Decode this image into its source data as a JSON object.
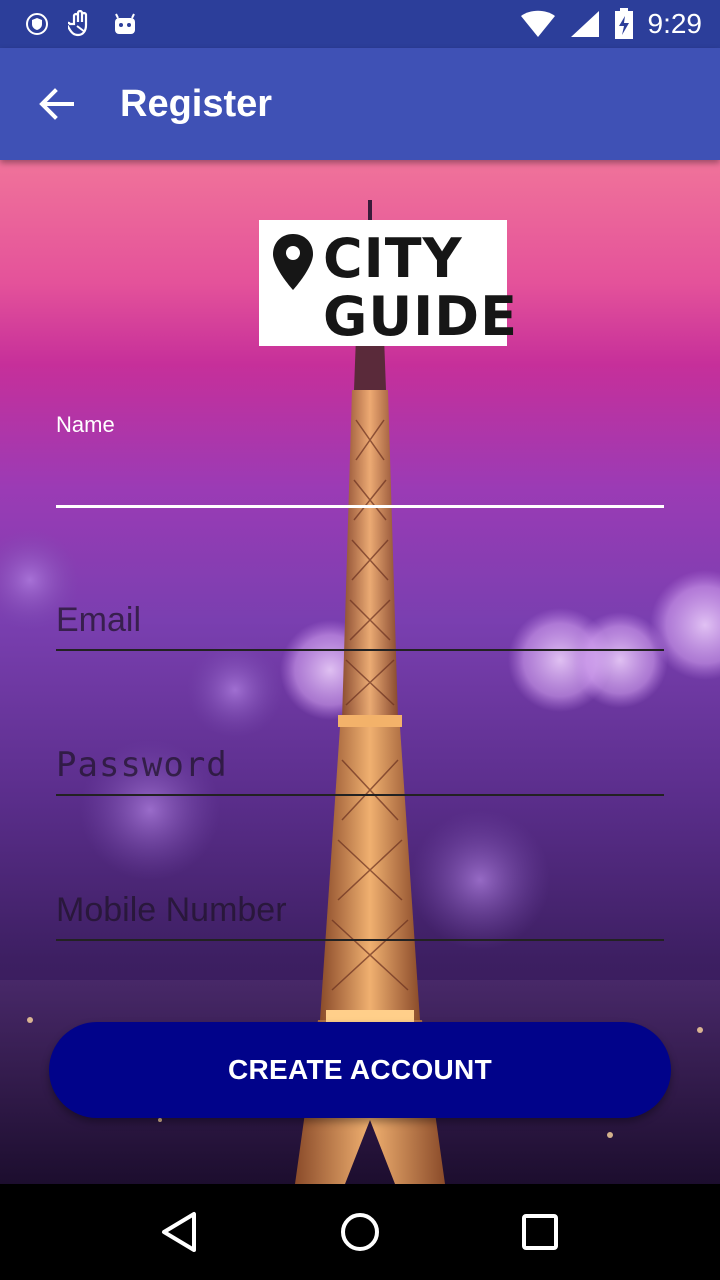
{
  "status_bar": {
    "time": "9:29",
    "left_icons": [
      "shield-icon",
      "hand-icon",
      "android-icon"
    ],
    "right_icons": [
      "wifi-icon",
      "signal-icon",
      "battery-charging-icon"
    ]
  },
  "app_bar": {
    "title": "Register",
    "back_icon": "arrow-back-icon",
    "color": "#3f51b5"
  },
  "logo": {
    "line1": "CITY",
    "line2": "GUIDE",
    "icon": "location-pin-icon"
  },
  "form": {
    "name": {
      "label": "Name",
      "value": ""
    },
    "email": {
      "placeholder": "Email"
    },
    "password": {
      "placeholder": "Password"
    },
    "mobile": {
      "placeholder": "Mobile Number"
    }
  },
  "button": {
    "label": "CREATE ACCOUNT",
    "color": "#01038a"
  },
  "nav_bar": {
    "icons": [
      "back-triangle-icon",
      "home-circle-icon",
      "recents-square-icon"
    ]
  }
}
